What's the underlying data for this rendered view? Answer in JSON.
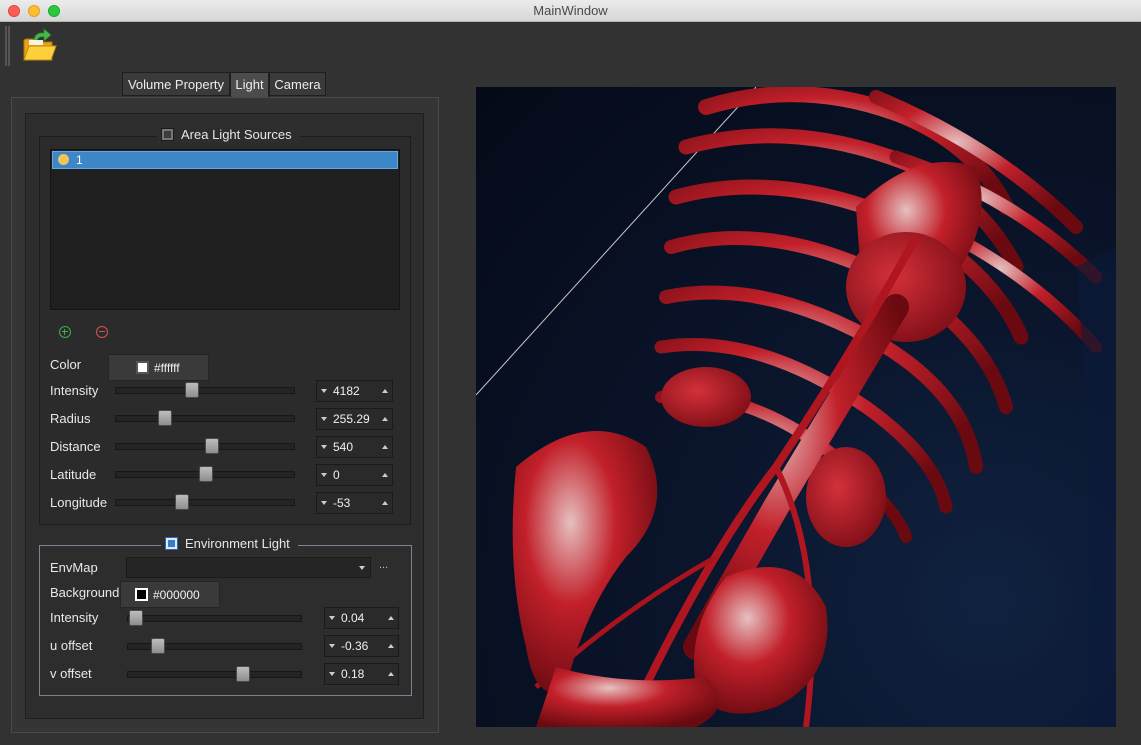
{
  "window": {
    "title": "MainWindow"
  },
  "toolbar": {
    "open_icon": "folder-open-icon"
  },
  "tabs": [
    {
      "label": "Volume Property"
    },
    {
      "label": "Light"
    },
    {
      "label": "Camera"
    }
  ],
  "area_light": {
    "title": "Area Light Sources",
    "checked": false,
    "list": [
      {
        "label": "1",
        "icon": "light-bulb-icon"
      }
    ],
    "add_icon": "plus-circle-icon",
    "remove_icon": "minus-circle-icon",
    "color_label": "Color",
    "color_value": "#ffffff",
    "sliders": [
      {
        "label": "Intensity",
        "value": "4182",
        "position": 0.42
      },
      {
        "label": "Radius",
        "value": "255.29",
        "position": 0.27
      },
      {
        "label": "Distance",
        "value": "540",
        "position": 0.54
      },
      {
        "label": "Latitude",
        "value": "0",
        "position": 0.5
      },
      {
        "label": "Longitude",
        "value": "-53",
        "position": 0.37
      }
    ]
  },
  "environment_light": {
    "title": "Environment Light",
    "checked": true,
    "envmap_label": "EnvMap",
    "envmap_value": "",
    "browse_label": "...",
    "background_label": "Background",
    "background_value": "#000000",
    "sliders": [
      {
        "label": "Intensity",
        "value": "0.04",
        "position": 0.02
      },
      {
        "label": "u offset",
        "value": "-0.36",
        "position": 0.17
      },
      {
        "label": "v offset",
        "value": "0.18",
        "position": 0.6
      }
    ]
  },
  "viewport": {
    "description_icon": "volume-render-viewport"
  },
  "colors": {
    "accent": "#3d86c8",
    "background": "#323232",
    "render_bone": "#c0202a"
  }
}
